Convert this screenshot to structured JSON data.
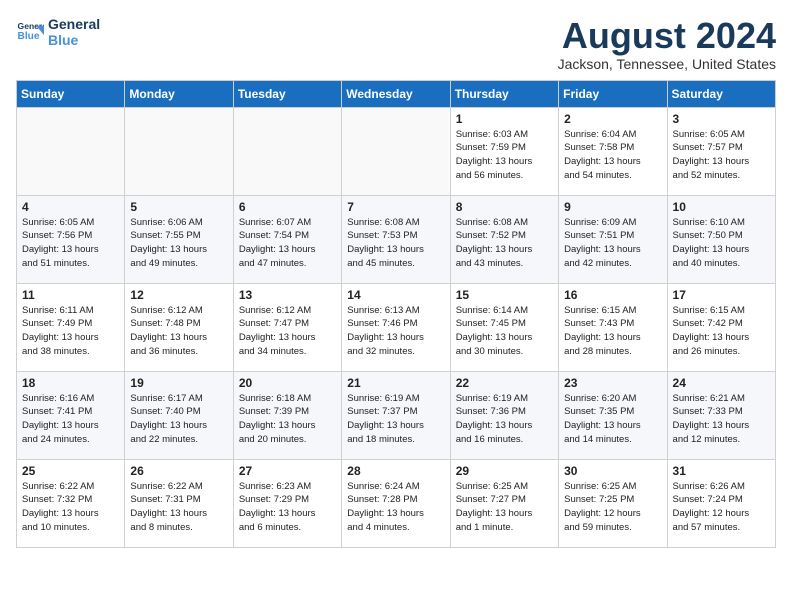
{
  "header": {
    "logo_line1": "General",
    "logo_line2": "Blue",
    "month_title": "August 2024",
    "location": "Jackson, Tennessee, United States"
  },
  "weekdays": [
    "Sunday",
    "Monday",
    "Tuesday",
    "Wednesday",
    "Thursday",
    "Friday",
    "Saturday"
  ],
  "weeks": [
    [
      {
        "day": "",
        "info": ""
      },
      {
        "day": "",
        "info": ""
      },
      {
        "day": "",
        "info": ""
      },
      {
        "day": "",
        "info": ""
      },
      {
        "day": "1",
        "info": "Sunrise: 6:03 AM\nSunset: 7:59 PM\nDaylight: 13 hours\nand 56 minutes."
      },
      {
        "day": "2",
        "info": "Sunrise: 6:04 AM\nSunset: 7:58 PM\nDaylight: 13 hours\nand 54 minutes."
      },
      {
        "day": "3",
        "info": "Sunrise: 6:05 AM\nSunset: 7:57 PM\nDaylight: 13 hours\nand 52 minutes."
      }
    ],
    [
      {
        "day": "4",
        "info": "Sunrise: 6:05 AM\nSunset: 7:56 PM\nDaylight: 13 hours\nand 51 minutes."
      },
      {
        "day": "5",
        "info": "Sunrise: 6:06 AM\nSunset: 7:55 PM\nDaylight: 13 hours\nand 49 minutes."
      },
      {
        "day": "6",
        "info": "Sunrise: 6:07 AM\nSunset: 7:54 PM\nDaylight: 13 hours\nand 47 minutes."
      },
      {
        "day": "7",
        "info": "Sunrise: 6:08 AM\nSunset: 7:53 PM\nDaylight: 13 hours\nand 45 minutes."
      },
      {
        "day": "8",
        "info": "Sunrise: 6:08 AM\nSunset: 7:52 PM\nDaylight: 13 hours\nand 43 minutes."
      },
      {
        "day": "9",
        "info": "Sunrise: 6:09 AM\nSunset: 7:51 PM\nDaylight: 13 hours\nand 42 minutes."
      },
      {
        "day": "10",
        "info": "Sunrise: 6:10 AM\nSunset: 7:50 PM\nDaylight: 13 hours\nand 40 minutes."
      }
    ],
    [
      {
        "day": "11",
        "info": "Sunrise: 6:11 AM\nSunset: 7:49 PM\nDaylight: 13 hours\nand 38 minutes."
      },
      {
        "day": "12",
        "info": "Sunrise: 6:12 AM\nSunset: 7:48 PM\nDaylight: 13 hours\nand 36 minutes."
      },
      {
        "day": "13",
        "info": "Sunrise: 6:12 AM\nSunset: 7:47 PM\nDaylight: 13 hours\nand 34 minutes."
      },
      {
        "day": "14",
        "info": "Sunrise: 6:13 AM\nSunset: 7:46 PM\nDaylight: 13 hours\nand 32 minutes."
      },
      {
        "day": "15",
        "info": "Sunrise: 6:14 AM\nSunset: 7:45 PM\nDaylight: 13 hours\nand 30 minutes."
      },
      {
        "day": "16",
        "info": "Sunrise: 6:15 AM\nSunset: 7:43 PM\nDaylight: 13 hours\nand 28 minutes."
      },
      {
        "day": "17",
        "info": "Sunrise: 6:15 AM\nSunset: 7:42 PM\nDaylight: 13 hours\nand 26 minutes."
      }
    ],
    [
      {
        "day": "18",
        "info": "Sunrise: 6:16 AM\nSunset: 7:41 PM\nDaylight: 13 hours\nand 24 minutes."
      },
      {
        "day": "19",
        "info": "Sunrise: 6:17 AM\nSunset: 7:40 PM\nDaylight: 13 hours\nand 22 minutes."
      },
      {
        "day": "20",
        "info": "Sunrise: 6:18 AM\nSunset: 7:39 PM\nDaylight: 13 hours\nand 20 minutes."
      },
      {
        "day": "21",
        "info": "Sunrise: 6:19 AM\nSunset: 7:37 PM\nDaylight: 13 hours\nand 18 minutes."
      },
      {
        "day": "22",
        "info": "Sunrise: 6:19 AM\nSunset: 7:36 PM\nDaylight: 13 hours\nand 16 minutes."
      },
      {
        "day": "23",
        "info": "Sunrise: 6:20 AM\nSunset: 7:35 PM\nDaylight: 13 hours\nand 14 minutes."
      },
      {
        "day": "24",
        "info": "Sunrise: 6:21 AM\nSunset: 7:33 PM\nDaylight: 13 hours\nand 12 minutes."
      }
    ],
    [
      {
        "day": "25",
        "info": "Sunrise: 6:22 AM\nSunset: 7:32 PM\nDaylight: 13 hours\nand 10 minutes."
      },
      {
        "day": "26",
        "info": "Sunrise: 6:22 AM\nSunset: 7:31 PM\nDaylight: 13 hours\nand 8 minutes."
      },
      {
        "day": "27",
        "info": "Sunrise: 6:23 AM\nSunset: 7:29 PM\nDaylight: 13 hours\nand 6 minutes."
      },
      {
        "day": "28",
        "info": "Sunrise: 6:24 AM\nSunset: 7:28 PM\nDaylight: 13 hours\nand 4 minutes."
      },
      {
        "day": "29",
        "info": "Sunrise: 6:25 AM\nSunset: 7:27 PM\nDaylight: 13 hours\nand 1 minute."
      },
      {
        "day": "30",
        "info": "Sunrise: 6:25 AM\nSunset: 7:25 PM\nDaylight: 12 hours\nand 59 minutes."
      },
      {
        "day": "31",
        "info": "Sunrise: 6:26 AM\nSunset: 7:24 PM\nDaylight: 12 hours\nand 57 minutes."
      }
    ]
  ]
}
